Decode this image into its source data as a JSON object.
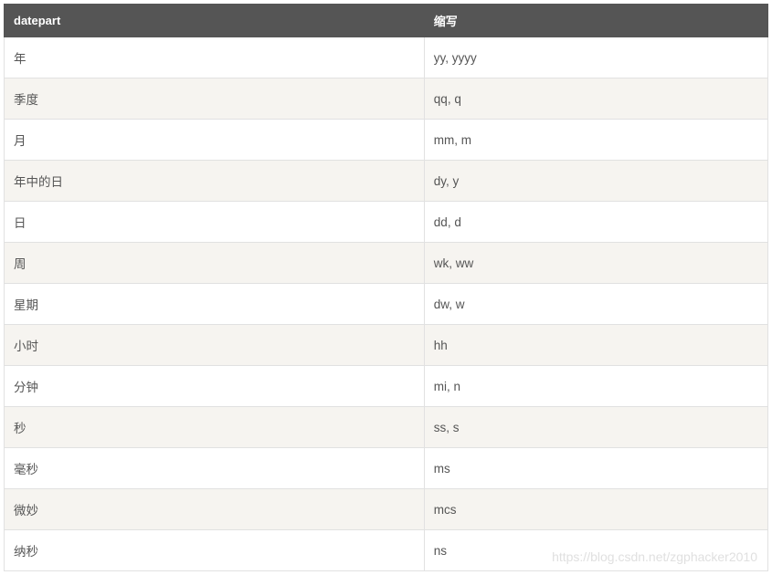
{
  "table": {
    "headers": {
      "col1": "datepart",
      "col2": "缩写"
    },
    "rows": [
      {
        "datepart": "年",
        "abbr": "yy, yyyy"
      },
      {
        "datepart": "季度",
        "abbr": "qq, q"
      },
      {
        "datepart": "月",
        "abbr": "mm, m"
      },
      {
        "datepart": "年中的日",
        "abbr": "dy, y"
      },
      {
        "datepart": "日",
        "abbr": "dd, d"
      },
      {
        "datepart": "周",
        "abbr": "wk, ww"
      },
      {
        "datepart": "星期",
        "abbr": "dw, w"
      },
      {
        "datepart": "小时",
        "abbr": "hh"
      },
      {
        "datepart": "分钟",
        "abbr": "mi, n"
      },
      {
        "datepart": "秒",
        "abbr": "ss, s"
      },
      {
        "datepart": "毫秒",
        "abbr": "ms"
      },
      {
        "datepart": "微妙",
        "abbr": "mcs"
      },
      {
        "datepart": "纳秒",
        "abbr": "ns"
      }
    ]
  },
  "watermark": "https://blog.csdn.net/zgphacker2010"
}
